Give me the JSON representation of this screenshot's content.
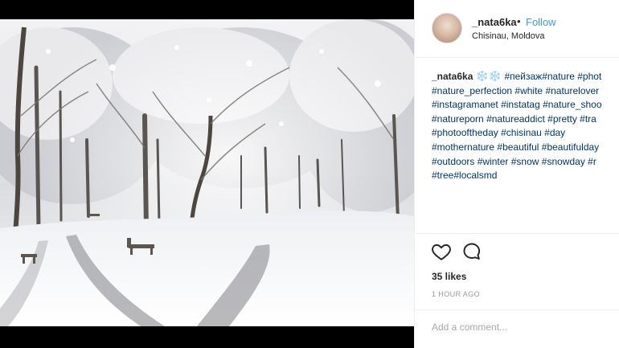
{
  "post": {
    "username": "_nata6ka",
    "separator": "•",
    "follow_label": "Follow",
    "location": "Chisinau, Moldova",
    "photo_description_icon": "snow-landscape-photo"
  },
  "caption": {
    "username": "_nata6ka",
    "emoji": "❄️❄️",
    "lines": [
      [
        "#пейзаж",
        "#nature",
        "#phot"
      ],
      [
        "#nature_perfection",
        "#white",
        "#naturelover"
      ],
      [
        "#instagramanet",
        "#instatag",
        "#nature_shoo"
      ],
      [
        "#natureporn",
        "#natureaddict",
        "#pretty",
        "#tra"
      ],
      [
        "#photooftheday",
        "#chisinau",
        "#day"
      ],
      [
        "#mothernature",
        "#beautiful",
        "#beautifulday"
      ],
      [
        "#outdoors",
        "#winter",
        "#snow",
        "#snowday",
        "#r"
      ],
      [
        "#tree",
        "#localsmd"
      ]
    ]
  },
  "actions": {
    "like_icon": "heart-icon",
    "comment_icon": "comment-bubble-icon"
  },
  "likes_text": "35 likes",
  "time_text": "1 HOUR AGO",
  "comment": {
    "placeholder": "Add a comment..."
  },
  "colors": {
    "link_blue": "#3897f0",
    "hashtag": "#003569",
    "muted": "#999999",
    "text": "#262626"
  }
}
